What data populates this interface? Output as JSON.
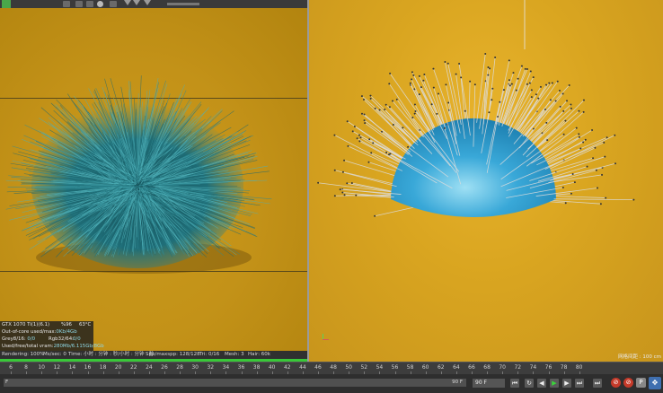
{
  "colors": {
    "render_bg": "#c4941a",
    "editor_bg": "#d9a520",
    "fur": "#2f8a94",
    "sphere": "#39a8d8",
    "guide_lines": "#dcdcdc",
    "progress_green": "#38c838"
  },
  "toolbar": {
    "icons": [
      "play-icon",
      "render-icon",
      "view-icon",
      "region-icon",
      "lock-icon",
      "sphere-icon",
      "down-arrow-icon",
      "down-arrow-icon",
      "down-arrow-icon"
    ]
  },
  "stats": {
    "gpu": "GTX 1070 Ti(1)(6.1)",
    "gpu_percent": "%96",
    "gpu_temp": "63°C",
    "out_of_core_label": "Out-of-core used/max:",
    "out_of_core_value": "0Kb/4Gb",
    "grey_label": "Grey8/16:",
    "grey_value": "0/0",
    "rgb_label": "Rgb32/64:",
    "rgb_value": "0/0",
    "vram_label": "Used/free/total vram:",
    "vram_value": "280Mb/6.115Gb/8Gb"
  },
  "statusbar": {
    "rendering": "Rendering: 100%",
    "ms_sec": "Ms/sec: 0",
    "time": "Time: 小时 : 分钟 : 秒/小时 : 分钟 : 秒",
    "spp": "Spp/maxspp: 128/128",
    "tri": "Tri: 0/16",
    "mesh": "Mesh: 3",
    "hair": "Hair: 60k"
  },
  "editor": {
    "scale_label": "网格间距 : 100 cm"
  },
  "timeline": {
    "ticks": [
      "6",
      "8",
      "10",
      "12",
      "14",
      "16",
      "18",
      "20",
      "22",
      "24",
      "26",
      "28",
      "30",
      "32",
      "34",
      "36",
      "38",
      "40",
      "42",
      "44",
      "46",
      "48",
      "50",
      "52",
      "54",
      "56",
      "58",
      "60",
      "62",
      "64",
      "66",
      "68",
      "70",
      "72",
      "74",
      "76",
      "78",
      "80"
    ]
  },
  "transport": {
    "frame_label": "F",
    "current_frame": "90 F",
    "end_frame": "90 F"
  }
}
